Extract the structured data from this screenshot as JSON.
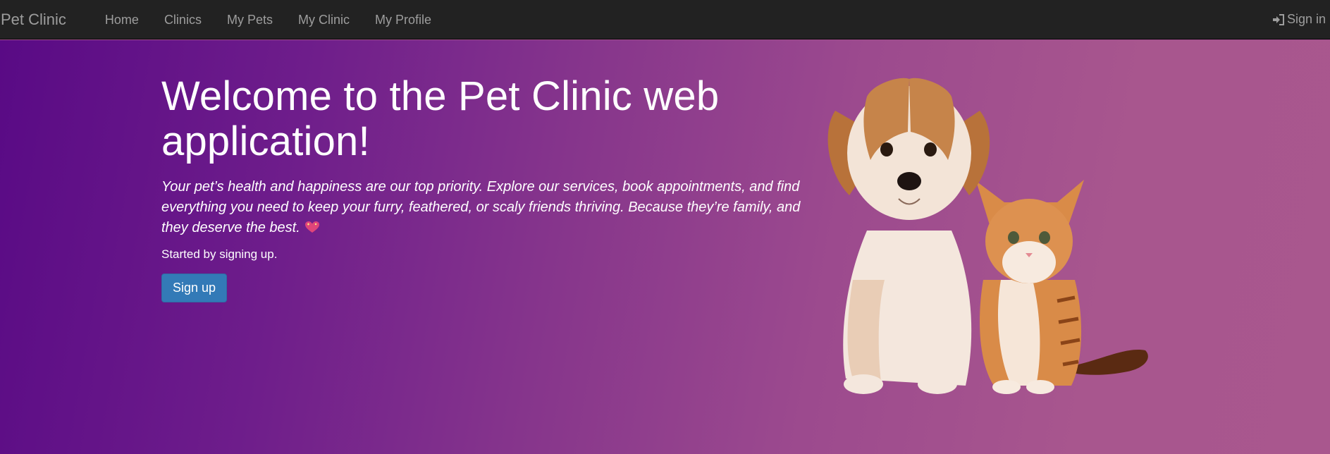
{
  "navbar": {
    "brand": "Pet Clinic",
    "items": [
      {
        "label": "Home"
      },
      {
        "label": "Clinics"
      },
      {
        "label": "My Pets"
      },
      {
        "label": "My Clinic"
      },
      {
        "label": "My Profile"
      }
    ],
    "signin_label": "Sign in",
    "signin_icon": "log-in-icon"
  },
  "hero": {
    "title": "Welcome to the Pet Clinic web application!",
    "lead": "Your pet’s health and happiness are our top priority. Explore our services, book appointments, and find everything you need to keep your furry, feathered, or scaly friends thriving. Because they’re family, and they deserve the best.",
    "lead_emoji": "heart-icon",
    "sub": "Started by signing up.",
    "signup_label": "Sign up",
    "image": "puppy-and-kitten-image"
  },
  "colors": {
    "navbar_bg": "#222222",
    "nav_text": "#9d9d9d",
    "hero_gradient_start": "#590a85",
    "hero_gradient_end": "#a9578e",
    "button": "#337ab7"
  }
}
